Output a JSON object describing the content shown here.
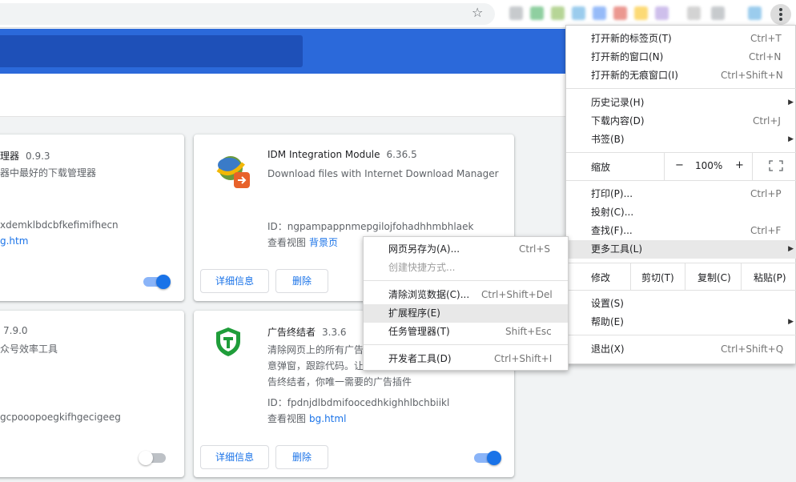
{
  "colors": {
    "accent": "#1a73e8",
    "header": "#2b69da"
  },
  "toolbar": {
    "bookmark_icon": "star-icon",
    "bookmark_glyph": "☆",
    "menu_icon": "kebab-menu-icon"
  },
  "cards": [
    {
      "name": "理器",
      "version": "0.9.3",
      "desc": [
        "器中最好的下载管理器"
      ],
      "id_line": "xdemklbdcbfkefimifhecn",
      "views_prefix": "",
      "view_link": "g.htm",
      "enabled": true
    },
    {
      "name": "IDM Integration Module",
      "version": "6.36.5",
      "desc": [
        "Download files with Internet Download Manager"
      ],
      "id_line": "ID：ngpampappnmepgilojfohadhhmbhlaek",
      "views_prefix": "查看视图",
      "view_link": "背景页",
      "details_label": "详细信息",
      "remove_label": "删除",
      "enabled": true
    },
    {
      "name": "",
      "version": "7.9.0",
      "desc": [
        "众号效率工具"
      ],
      "id_line": "gcpooopoegkifhgecigeeg",
      "enabled": false
    },
    {
      "name": "广告终结者",
      "version": "3.3.6",
      "desc": [
        "清除网页上的所有广告，",
        "意弹窗，跟踪代码。让",
        "告终结者，你唯一需要的广告插件"
      ],
      "id_line": "ID：fpdnjdlbdmifoocedhkighhlbchbiikl",
      "views_prefix": "查看视图",
      "view_link": "bg.html",
      "details_label": "详细信息",
      "remove_label": "删除",
      "enabled": true
    }
  ],
  "chrome_menu": {
    "new_tab": {
      "label": "打开新的标签页(T)",
      "shortcut": "Ctrl+T"
    },
    "new_window": {
      "label": "打开新的窗口(N)",
      "shortcut": "Ctrl+N"
    },
    "new_incognito": {
      "label": "打开新的无痕窗口(I)",
      "shortcut": "Ctrl+Shift+N"
    },
    "history": {
      "label": "历史记录(H)"
    },
    "downloads": {
      "label": "下载内容(D)",
      "shortcut": "Ctrl+J"
    },
    "bookmarks": {
      "label": "书签(B)"
    },
    "zoom": {
      "label": "缩放",
      "minus": "−",
      "value": "100%",
      "plus": "+"
    },
    "print": {
      "label": "打印(P)...",
      "shortcut": "Ctrl+P"
    },
    "cast": {
      "label": "投射(C)..."
    },
    "find": {
      "label": "查找(F)...",
      "shortcut": "Ctrl+F"
    },
    "more_tools": {
      "label": "更多工具(L)"
    },
    "edit": {
      "label": "修改",
      "cut": "剪切(T)",
      "copy": "复制(C)",
      "paste": "粘贴(P)"
    },
    "settings": {
      "label": "设置(S)"
    },
    "help": {
      "label": "帮助(E)"
    },
    "exit": {
      "label": "退出(X)",
      "shortcut": "Ctrl+Shift+Q"
    }
  },
  "more_tools_menu": {
    "save_page": {
      "label": "网页另存为(A)...",
      "shortcut": "Ctrl+S"
    },
    "create_shortcut": {
      "label": "创建快捷方式..."
    },
    "clear_data": {
      "label": "清除浏览数据(C)...",
      "shortcut": "Ctrl+Shift+Del"
    },
    "extensions": {
      "label": "扩展程序(E)"
    },
    "task_manager": {
      "label": "任务管理器(T)",
      "shortcut": "Shift+Esc"
    },
    "dev_tools": {
      "label": "开发者工具(D)",
      "shortcut": "Ctrl+Shift+I"
    }
  }
}
